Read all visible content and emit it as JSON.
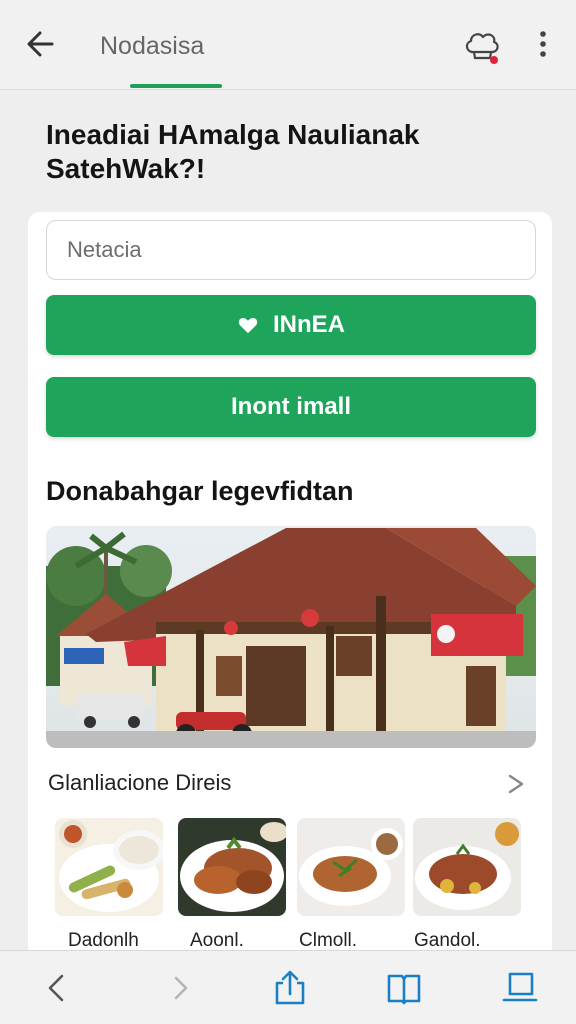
{
  "appbar": {
    "title": "Nodasisa",
    "icons": {
      "back": "arrow-left-icon",
      "profile": "chef-hat-icon",
      "more": "more-vert-icon"
    },
    "accent": "#1ea059"
  },
  "headline": "Ineadiai HAmalga Naulianak SatehWak?!",
  "search": {
    "placeholder": "Netacia",
    "value": ""
  },
  "buttons": {
    "primary_label": "INnEA",
    "secondary_label": "Inont imall",
    "color": "#1ea55b",
    "primary_icon": "heart-icon"
  },
  "section": {
    "title": "Donabahgar legevfidtan"
  },
  "hero": {
    "alt_icon": "restaurant-photo"
  },
  "subsection": {
    "title": "Glanliacione Direis",
    "chevron": "chevron-right-icon"
  },
  "dishes": [
    {
      "label": "Dadonlh"
    },
    {
      "label": "Aoonl."
    },
    {
      "label": "Clmoll."
    },
    {
      "label": "Gandol."
    }
  ],
  "bottom_nav": {
    "icons": [
      "chevron-left-icon",
      "chevron-right-icon",
      "share-icon",
      "book-icon",
      "tabs-icon"
    ],
    "accent": "#1c7fc4"
  }
}
